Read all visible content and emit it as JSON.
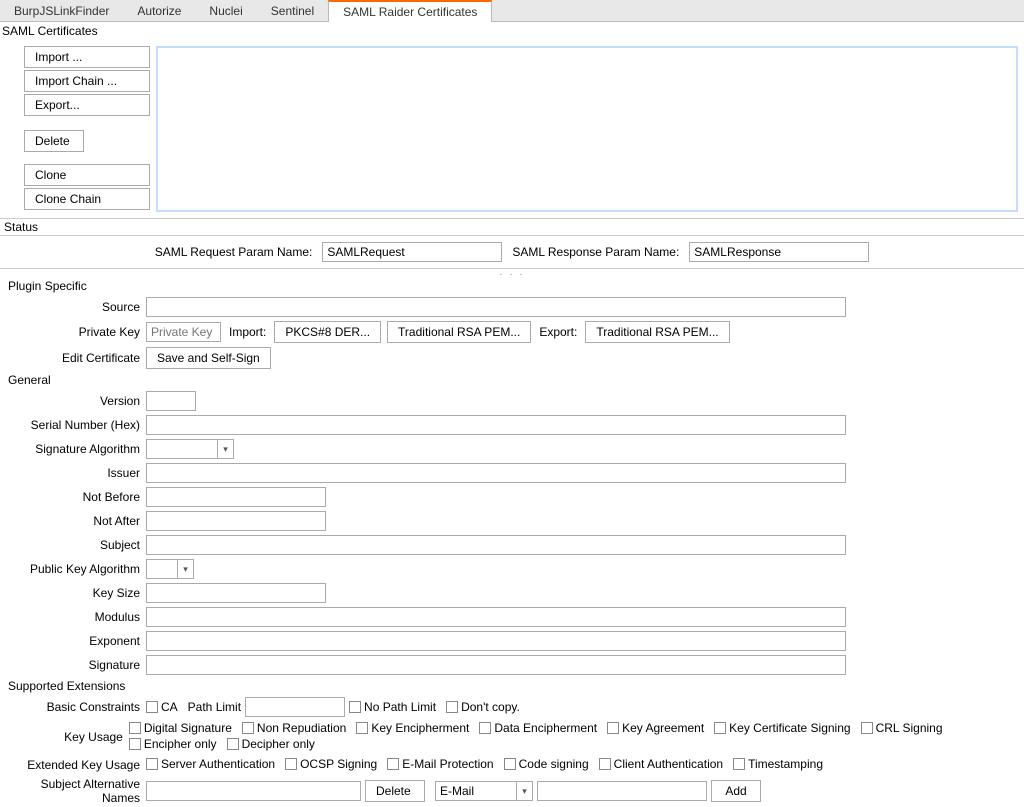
{
  "tabs": [
    "BurpJSLinkFinder",
    "Autorize",
    "Nuclei",
    "Sentinel",
    "SAML Raider Certificates"
  ],
  "activeTab": 4,
  "sections": {
    "samlCertificates": "SAML Certificates",
    "status": "Status",
    "pluginSpecific": "Plugin Specific",
    "general": "General",
    "supportedExtensions": "Supported Extensions"
  },
  "certButtons": {
    "import": "Import  ...",
    "importChain": "Import Chain ...",
    "export": "Export...",
    "delete": "Delete",
    "clone": "Clone",
    "cloneChain": "Clone Chain"
  },
  "params": {
    "reqLabel": "SAML Request Param Name:",
    "reqValue": "SAMLRequest",
    "resLabel": "SAML Response Param Name:",
    "resValue": "SAMLResponse"
  },
  "plugin": {
    "sourceLabel": "Source",
    "sourceValue": "",
    "privateKeyLabel": "Private Key",
    "privateKeyPlaceholder": "Private Key",
    "importLabel": "Import:",
    "pkcs8": "PKCS#8 DER...",
    "tradRsaImport": "Traditional RSA PEM...",
    "exportLabel": "Export:",
    "tradRsaExport": "Traditional RSA PEM...",
    "editCertLabel": "Edit Certificate",
    "saveSelfSign": "Save and Self-Sign"
  },
  "general": {
    "versionLabel": "Version",
    "versionValue": "",
    "serialLabel": "Serial Number (Hex)",
    "serialValue": "",
    "sigAlgLabel": "Signature Algorithm",
    "sigAlgValue": "",
    "issuerLabel": "Issuer",
    "issuerValue": "",
    "notBeforeLabel": "Not Before",
    "notBeforeValue": "",
    "notAfterLabel": "Not After",
    "notAfterValue": "",
    "subjectLabel": "Subject",
    "subjectValue": "",
    "pubKeyAlgLabel": "Public Key Algorithm",
    "pubKeyAlgValue": "",
    "keySizeLabel": "Key Size",
    "keySizeValue": "",
    "modulusLabel": "Modulus",
    "modulusValue": "",
    "exponentLabel": "Exponent",
    "exponentValue": "",
    "signatureLabel": "Signature",
    "signatureValue": ""
  },
  "ext": {
    "basicConstraintsLabel": "Basic Constraints",
    "caLabel": "CA",
    "pathLimitLabel": "Path Limit",
    "pathLimitValue": "",
    "noPathLimitLabel": "No Path Limit",
    "dontCopyLabel": "Don't copy.",
    "keyUsageLabel": "Key Usage",
    "keyUsage": [
      "Digital Signature",
      "Non Repudiation",
      "Key Encipherment",
      "Data Encipherment",
      "Key Agreement",
      "Key Certificate Signing",
      "CRL Signing",
      "Encipher only",
      "Decipher only"
    ],
    "extKeyUsageLabel": "Extended Key Usage",
    "extKeyUsage": [
      "Server Authentication",
      "OCSP Signing",
      "E-Mail Protection",
      "Code signing",
      "Client Authentication",
      "Timestamping"
    ],
    "sanLabel": "Subject Alternative Names",
    "sanValue": "",
    "deleteBtn": "Delete",
    "typeValue": "E-Mail",
    "typeInput": "",
    "addBtn": "Add"
  }
}
